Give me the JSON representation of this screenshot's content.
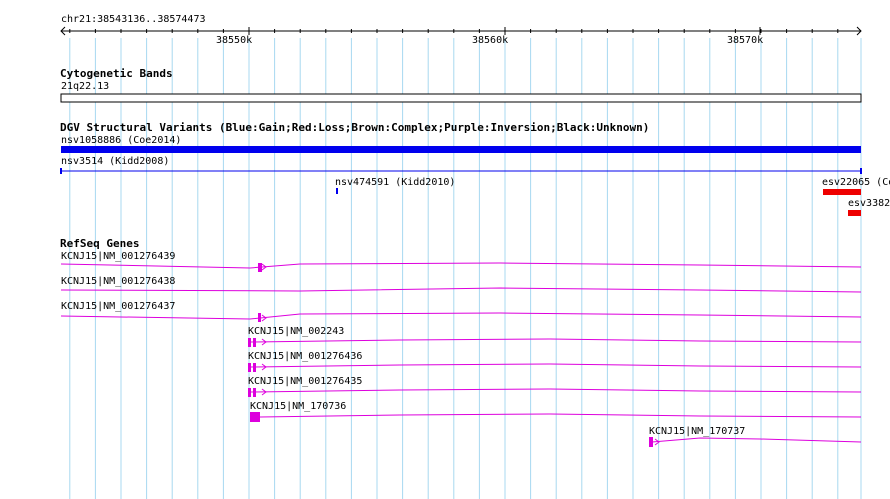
{
  "ruler": {
    "location": "chr21:38543136..38574473",
    "ticks": [
      "38550k",
      "38560k",
      "38570k"
    ]
  },
  "cytoband": {
    "track_title": "Cytogenetic Bands",
    "band_label": "21q22.13"
  },
  "dgv": {
    "track_title": "DGV Structural Variants (Blue:Gain;Red:Loss;Brown:Complex;Purple:Inversion;Black:Unknown)",
    "features": [
      {
        "label": "nsv1058886 (Coe2014)",
        "type": "gain"
      },
      {
        "label": "nsv3514 (Kidd2008)",
        "type": "gain"
      },
      {
        "label": "nsv474591 (Kidd2010)",
        "type": "gain"
      },
      {
        "label": "esv22065 (Co",
        "type": "loss"
      },
      {
        "label": "esv3382",
        "type": "loss"
      }
    ]
  },
  "refseq": {
    "track_title": "RefSeq Genes",
    "transcripts": [
      {
        "label": "KCNJ15|NM_001276439"
      },
      {
        "label": "KCNJ15|NM_001276438"
      },
      {
        "label": "KCNJ15|NM_001276437"
      },
      {
        "label": "KCNJ15|NM_002243"
      },
      {
        "label": "KCNJ15|NM_001276436"
      },
      {
        "label": "KCNJ15|NM_001276435"
      },
      {
        "label": "KCNJ15|NM_170736"
      },
      {
        "label": "KCNJ15|NM_170737"
      }
    ]
  },
  "colors": {
    "grid": "#a8d8f0",
    "gain": "#0000ee",
    "loss": "#ee0000",
    "gene": "#dd00dd"
  }
}
